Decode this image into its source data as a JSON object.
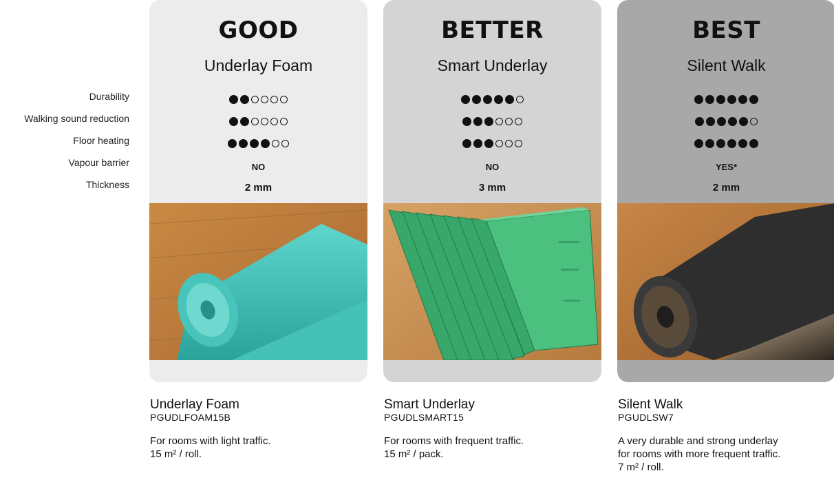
{
  "attributes": [
    "Durability",
    "Walking sound reduction",
    "Floor heating",
    "Vapour barrier",
    "Thickness"
  ],
  "cards": [
    {
      "tier": "GOOD",
      "name": "Underlay Foam",
      "bg": "#ececec",
      "durability": 2,
      "sound_reduction": 2,
      "floor_heating": 4,
      "vapour_barrier": "NO",
      "thickness": "2 mm",
      "image": "teal foam underlay roll on wood floor",
      "code": "PGUDLFOAM15B",
      "desc_line1": "For rooms with light traffic.",
      "desc_line2": "15 m² / roll.",
      "desc_line3": ""
    },
    {
      "tier": "BETTER",
      "name": "Smart Underlay",
      "bg": "#d4d4d4",
      "durability": 5,
      "sound_reduction": 3,
      "floor_heating": 3,
      "vapour_barrier": "NO",
      "thickness": "3 mm",
      "image": "folded green underlay boards on wood floor",
      "code": "PGUDLSMART15",
      "desc_line1": "For rooms with frequent traffic.",
      "desc_line2": "15 m² / pack.",
      "desc_line3": ""
    },
    {
      "tier": "BEST",
      "name": "Silent Walk",
      "bg": "#a8a8a8",
      "durability": 6,
      "sound_reduction": 5,
      "floor_heating": 6,
      "vapour_barrier": "YES*",
      "thickness": "2 mm",
      "image": "black underlay roll with foil backing on wood floor",
      "code": "PGUDLSW7",
      "desc_line1": "A very durable and strong underlay",
      "desc_line2": "for rooms with more frequent traffic.",
      "desc_line3": "7 m² / roll."
    }
  ],
  "max_dots": 6
}
